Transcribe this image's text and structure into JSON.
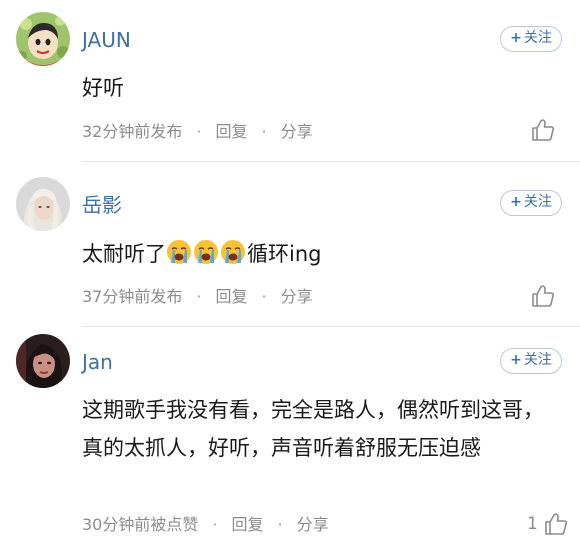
{
  "comments": [
    {
      "username": "JAUN",
      "follow_label": "关注",
      "content": "好听",
      "time": "32分钟前发布",
      "reply_label": "回复",
      "share_label": "分享",
      "like_count": ""
    },
    {
      "username": "岳影",
      "follow_label": "关注",
      "content_before": "太耐听了",
      "content_after": "循环ing",
      "emojis": [
        "loudly-crying-face",
        "loudly-crying-face",
        "loudly-crying-face"
      ],
      "time": "37分钟前发布",
      "reply_label": "回复",
      "share_label": "分享",
      "like_count": ""
    },
    {
      "username": "Jan",
      "follow_label": "关注",
      "content": "这期歌手我没有看，完全是路人，偶然听到这哥，真的太抓人，好听，声音听着舒服无压迫感",
      "time": "30分钟前被点赞",
      "reply_label": "回复",
      "share_label": "分享",
      "like_count": "1"
    }
  ],
  "colors": {
    "username": "#3d6fa8",
    "meta": "#8c8c8c",
    "follow_border": "#b9c9db"
  }
}
